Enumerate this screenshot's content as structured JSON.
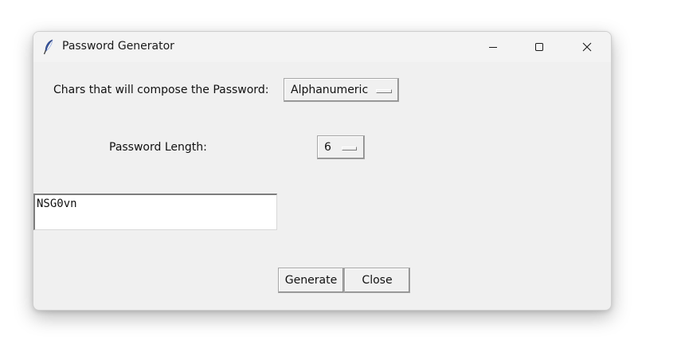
{
  "window": {
    "title": "Password Generator"
  },
  "titlebar": {
    "icons": {
      "app": "feather-icon",
      "minimize": "minimize-icon",
      "maximize": "maximize-icon",
      "close": "close-icon"
    }
  },
  "form": {
    "chars_label": "Chars that will compose the Password:",
    "chars_value": "Alphanumeric",
    "length_label": "Password Length:",
    "length_value": "6",
    "output_value": "NSG0vn"
  },
  "buttons": {
    "generate_label": "Generate",
    "close_label": "Close"
  }
}
